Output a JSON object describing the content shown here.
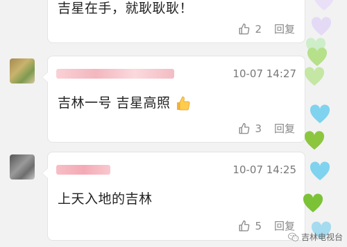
{
  "comments": [
    {
      "text": "吉星在手，就耿耿耿！",
      "time": "",
      "likes": "2",
      "reply_label": "回复"
    },
    {
      "text": "吉林一号 吉星高照",
      "time": "10-07 14:27",
      "likes": "3",
      "reply_label": "回复",
      "emoji": "thumbs-up-emoji"
    },
    {
      "text": "上天入地的吉林",
      "time": "10-07 14:25",
      "likes": "5",
      "reply_label": "回复"
    }
  ],
  "watermark": {
    "text": "吉林电视台",
    "icon": "wechat-icon"
  },
  "colors": {
    "heart_purple": "#e6dcf7",
    "heart_green": "#8cc63f",
    "heart_lightgreen": "#b6e08a",
    "heart_blue": "#7fd3ee",
    "name_blur": "#f7c8ce"
  }
}
